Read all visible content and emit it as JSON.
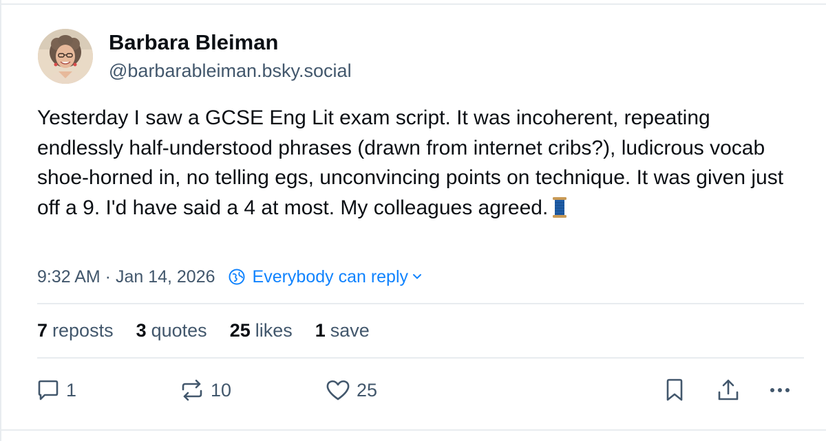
{
  "author": {
    "name": "Barbara Bleiman",
    "handle": "@barbarableiman.bsky.social"
  },
  "post": {
    "text": "Yesterday I saw a GCSE Eng Lit exam script. It was incoherent, repeating endlessly half-understood phrases (drawn from internet cribs?), ludicrous vocab shoe-horned in, no telling egs, unconvincing points on technique. It was given just off a 9. I'd have said a 4 at most. My colleagues agreed.",
    "emoji": "spool-of-thread-icon",
    "timestamp": "9:32 AM · Jan 14, 2026",
    "reply_setting": "Everybody can reply"
  },
  "stats": [
    {
      "count": "7",
      "label": "reposts"
    },
    {
      "count": "3",
      "label": "quotes"
    },
    {
      "count": "25",
      "label": "likes"
    },
    {
      "count": "1",
      "label": "save"
    }
  ],
  "actions": {
    "reply_count": "1",
    "repost_count": "10",
    "like_count": "25"
  },
  "colors": {
    "text": "#0b0f14",
    "muted": "#42576c",
    "accent": "#1083fe",
    "divider": "#e8ecef"
  }
}
